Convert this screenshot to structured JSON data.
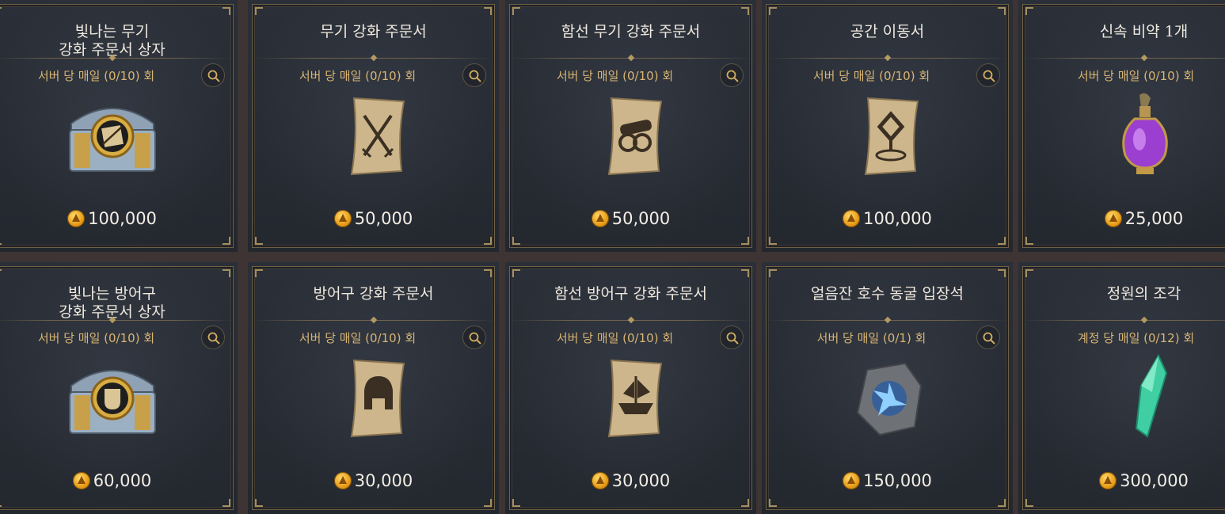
{
  "shop": {
    "items": [
      {
        "title": "빛나는 무기\n강화 주문서 상자",
        "limit": "서버 당 매일 (0/10) 회",
        "price": "100,000",
        "icon": "treasure-chest-sword-icon",
        "has_zoom": true
      },
      {
        "title": "무기 강화 주문서",
        "limit": "서버 당 매일 (0/10) 회",
        "price": "50,000",
        "icon": "scroll-crossed-swords-icon",
        "has_zoom": true
      },
      {
        "title": "함선 무기 강화 주문서",
        "limit": "서버 당 매일 (0/10) 회",
        "price": "50,000",
        "icon": "scroll-cannon-icon",
        "has_zoom": true
      },
      {
        "title": "공간 이동서",
        "limit": "서버 당 매일 (0/10) 회",
        "price": "100,000",
        "icon": "scroll-teleport-icon",
        "has_zoom": true
      },
      {
        "title": "신속 비약 1개",
        "limit": "서버 당 매일 (0/10) 회",
        "price": "25,000",
        "icon": "purple-potion-icon",
        "has_zoom": false
      },
      {
        "title": "빛나는 방어구\n강화 주문서 상자",
        "limit": "서버 당 매일 (0/10) 회",
        "price": "60,000",
        "icon": "treasure-chest-armor-icon",
        "has_zoom": true
      },
      {
        "title": "방어구 강화 주문서",
        "limit": "서버 당 매일 (0/10) 회",
        "price": "30,000",
        "icon": "scroll-helmet-icon",
        "has_zoom": true
      },
      {
        "title": "함선 방어구 강화 주문서",
        "limit": "서버 당 매일 (0/10) 회",
        "price": "30,000",
        "icon": "scroll-ship-icon",
        "has_zoom": true
      },
      {
        "title": "얼음잔 호수 동굴 입장석",
        "limit": "서버 당 매일 (0/1) 회",
        "price": "150,000",
        "icon": "blue-rune-stone-icon",
        "has_zoom": true
      },
      {
        "title": "정원의 조각",
        "limit": "계정 당 매일 (0/12) 회",
        "price": "300,000",
        "icon": "green-crystal-shard-icon",
        "has_zoom": false
      }
    ]
  },
  "colors": {
    "title": "#efe9de",
    "limit": "#d8b574",
    "price": "#f3eee5",
    "frame": "#6f6146",
    "coin": "#f0b431"
  }
}
